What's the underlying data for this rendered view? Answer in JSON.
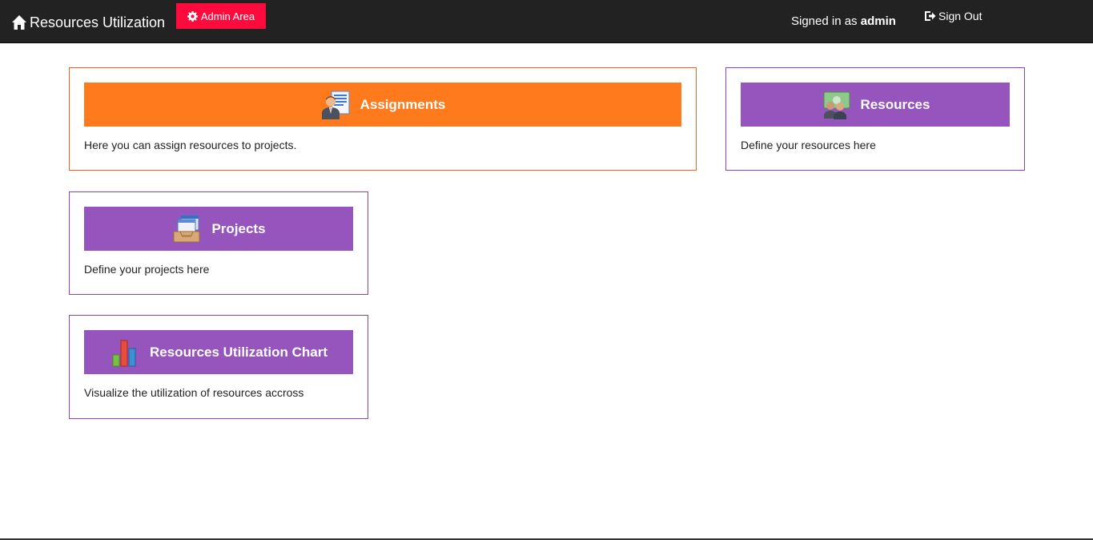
{
  "navbar": {
    "brand": "Resources Utilization",
    "admin_label": "Admin Area",
    "signed_in_prefix": "Signed in as",
    "username": "admin",
    "signout_label": "Sign Out"
  },
  "cards": {
    "assignments": {
      "title": "Assignments",
      "text": "Here you can assign resources to projects.",
      "icon": "assignment-person-icon",
      "color": "#ff7a1c"
    },
    "resources": {
      "title": "Resources",
      "text": "Define your resources here",
      "icon": "resources-people-icon",
      "color": "#9654bd"
    },
    "projects": {
      "title": "Projects",
      "text": "Define your projects here",
      "icon": "projects-tray-icon",
      "color": "#9654bd"
    },
    "chart": {
      "title": "Resources Utilization Chart",
      "text": "Visualize the utilization of resources accross",
      "icon": "bar-chart-icon",
      "color": "#9654bd"
    }
  },
  "colors": {
    "navbar": "#222222",
    "admin_button": "#ff0a3c",
    "accent_orange": "#ff7a1c",
    "accent_purple": "#9654bd"
  }
}
